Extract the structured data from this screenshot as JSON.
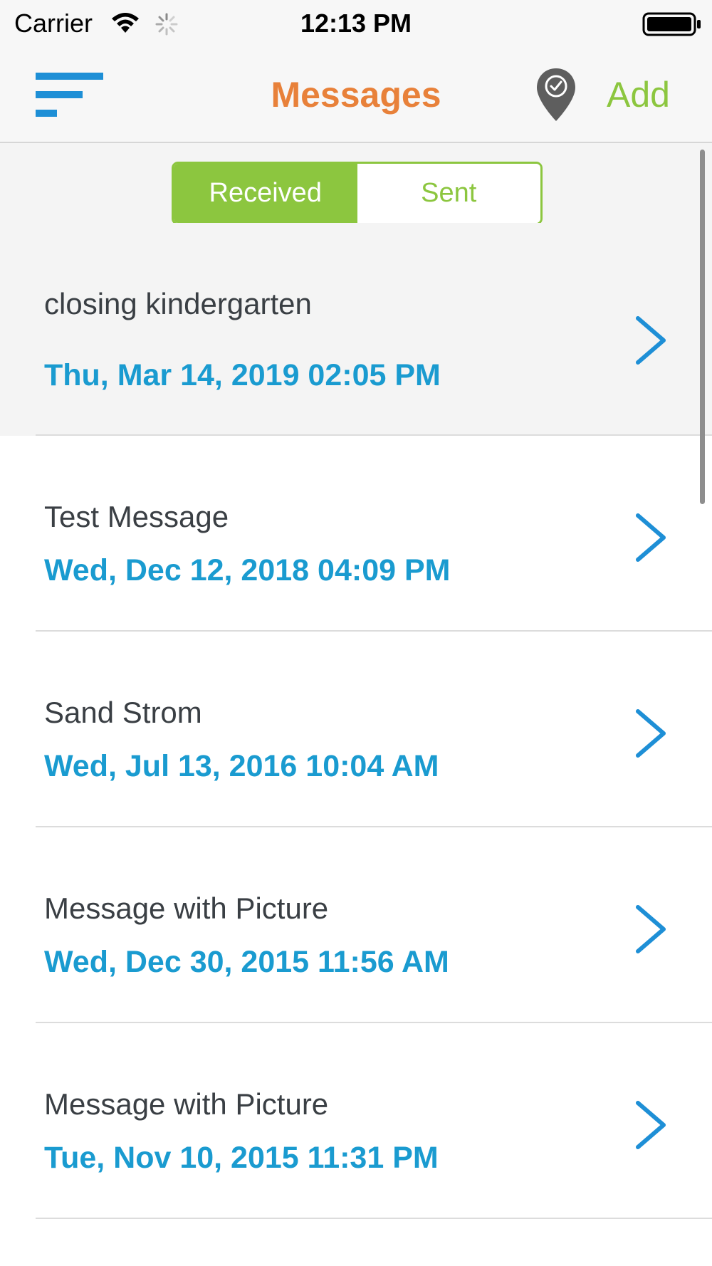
{
  "status_bar": {
    "carrier": "Carrier",
    "time": "12:13 PM",
    "wifi_icon": "wifi-icon",
    "activity_icon": "spinner-icon",
    "battery_icon": "battery-icon"
  },
  "nav_bar": {
    "menu_icon": "menu-icon",
    "title": "Messages",
    "location_icon": "location-check-icon",
    "add_label": "Add",
    "colors": {
      "title": "#e8813a",
      "accent": "#8cc63f"
    }
  },
  "segment": {
    "received_label": "Received",
    "sent_label": "Sent",
    "selected": "Received"
  },
  "messages": [
    {
      "title": "closing kindergarten",
      "date": "Thu, Mar 14, 2019 02:05 PM"
    },
    {
      "title": "Test Message",
      "date": "Wed, Dec 12, 2018 04:09 PM"
    },
    {
      "title": "Sand Strom",
      "date": "Wed, Jul 13, 2016 10:04 AM"
    },
    {
      "title": "Message with Picture",
      "date": "Wed, Dec 30, 2015 11:56 AM"
    },
    {
      "title": "Message with Picture",
      "date": "Tue, Nov 10, 2015 11:31 PM"
    }
  ],
  "colors": {
    "date_text": "#1a9bd0",
    "chevron": "#1e8fd6",
    "title_text": "#3a3f44"
  }
}
